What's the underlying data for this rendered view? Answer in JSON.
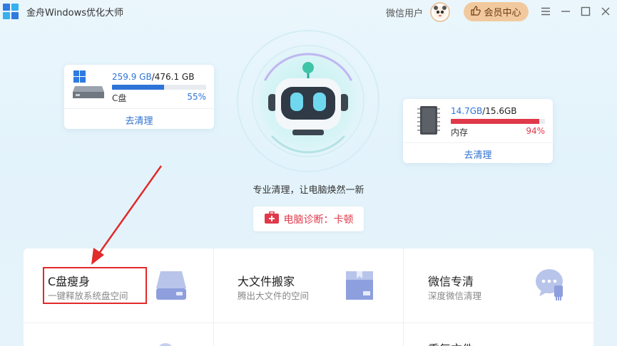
{
  "app": {
    "title": "金舟Windows优化大师"
  },
  "header": {
    "user_label": "微信用户",
    "vip_label": "会员中心"
  },
  "disk": {
    "used": "259.9 GB",
    "total": "/476.1 GB",
    "label": "C盘",
    "percent_text": "55%",
    "fraction": 0.55,
    "action": "去清理"
  },
  "memory": {
    "used": "14.7GB",
    "total": "/15.6GB",
    "label": "内存",
    "percent_text": "94%",
    "fraction": 0.94,
    "action": "去清理"
  },
  "center": {
    "slogan": "专业清理，让电脑焕然一新",
    "diagnosis": "电脑诊断：卡顿"
  },
  "tools": [
    {
      "title": "C盘瘦身",
      "subtitle": "一键释放系统盘空间"
    },
    {
      "title": "大文件搬家",
      "subtitle": "腾出大文件的空间"
    },
    {
      "title": "微信专清",
      "subtitle": "深度微信清理"
    },
    {
      "title": "重复文件"
    }
  ],
  "colors": {
    "accent": "#2d74d8",
    "danger": "#e0394a",
    "vip": "#f2c99e",
    "highlight": "#e12a2a"
  }
}
